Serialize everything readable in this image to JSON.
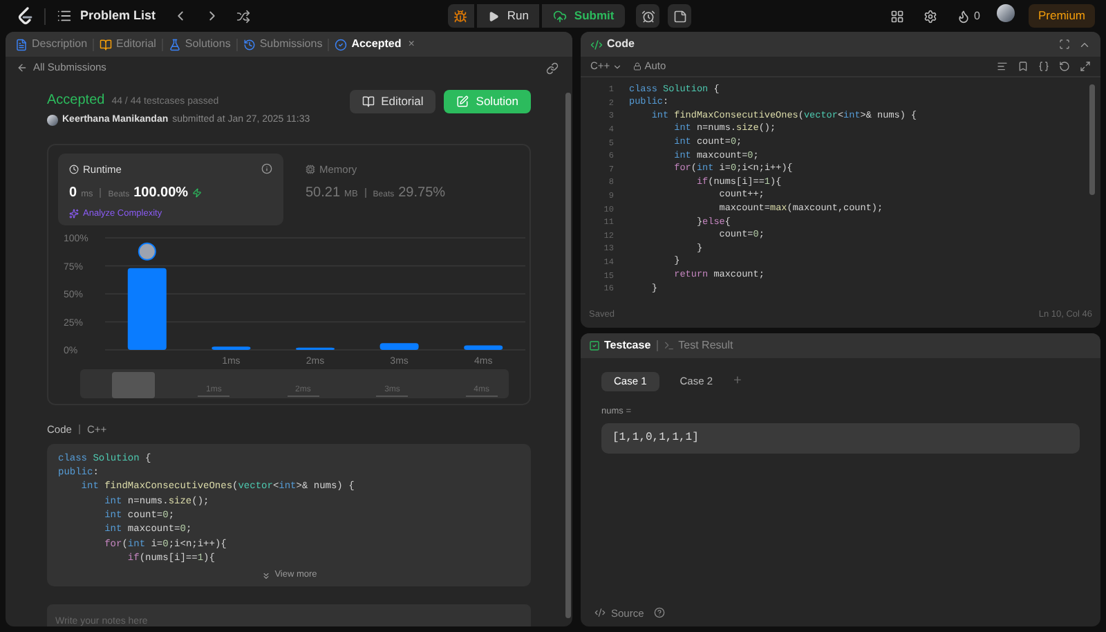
{
  "top_bar": {
    "title": "Problem List",
    "run": "Run",
    "submit": "Submit",
    "streak": "0",
    "premium": "Premium"
  },
  "tabs": [
    {
      "label": "Description",
      "kind": "description",
      "selected": false
    },
    {
      "label": "Editorial",
      "kind": "editorial",
      "selected": false
    },
    {
      "label": "Solutions",
      "kind": "solutions",
      "selected": false
    },
    {
      "label": "Submissions",
      "kind": "submissions",
      "selected": false
    },
    {
      "label": "Accepted",
      "kind": "accepted",
      "selected": true,
      "close": "×"
    }
  ],
  "back_link": "All Submissions",
  "result": {
    "status": "Accepted",
    "testcases": "44 / 44 testcases passed",
    "author": "Keerthana Manikandan",
    "submitted": "submitted at Jan 27, 2025 11:33",
    "buttons": [
      {
        "label": "Editorial",
        "kind": "plain"
      },
      {
        "label": "Solution",
        "kind": "primary"
      }
    ]
  },
  "stats": [
    {
      "title": "Runtime",
      "kind": "runtime",
      "selected": true,
      "value": "0",
      "unit": "ms",
      "beats_label": "Beats",
      "beats": "100.00%",
      "action": "Analyze Complexity"
    },
    {
      "title": "Memory",
      "kind": "memory",
      "selected": false,
      "value": "50.21",
      "unit": "MB",
      "beats_label": "Beats",
      "beats": "29.75%"
    }
  ],
  "chart_data": {
    "type": "bar",
    "x": [
      0,
      1,
      2,
      3,
      4
    ],
    "values": [
      73,
      3,
      2,
      6,
      4
    ],
    "grid": true,
    "xlim": [
      -0.5,
      4.5
    ],
    "ylim": [
      0,
      100
    ],
    "xticks": [
      {
        "value": 1,
        "label": "1ms"
      },
      {
        "value": 2,
        "label": "2ms"
      },
      {
        "value": 3,
        "label": "3ms"
      },
      {
        "value": 4,
        "label": "4ms"
      }
    ],
    "yticks": [
      {
        "value": 100,
        "label": "100%"
      },
      {
        "value": 75,
        "label": "75%"
      },
      {
        "value": 50,
        "label": "50%"
      },
      {
        "value": 25,
        "label": "25%"
      },
      {
        "value": 0,
        "label": "0%"
      }
    ]
  },
  "overview": {
    "labels": [
      "1ms",
      "2ms",
      "3ms",
      "4ms"
    ],
    "level": 0.1
  },
  "code_section": {
    "title": "Code",
    "language": "C++",
    "view_more": "View more",
    "lines": [
      [
        {
          "kind": "kw",
          "text": "class "
        },
        {
          "kind": "type",
          "text": "Solution"
        },
        {
          "kind": "plain",
          "text": " {"
        }
      ],
      [
        {
          "kind": "kw",
          "text": "public"
        },
        {
          "kind": "plain",
          "text": ":"
        }
      ],
      [
        {
          "kind": "kw",
          "text": "    int "
        },
        {
          "kind": "fn",
          "text": "findMaxConsecutiveOnes"
        },
        {
          "kind": "plain",
          "text": "("
        },
        {
          "kind": "type",
          "text": "vector"
        },
        {
          "kind": "plain",
          "text": "<"
        },
        {
          "kind": "kw",
          "text": "int"
        },
        {
          "kind": "plain",
          "text": ">& nums) {"
        }
      ],
      [
        {
          "kind": "kw",
          "text": "        int "
        },
        {
          "kind": "plain",
          "text": "n=nums."
        },
        {
          "kind": "fn",
          "text": "size"
        },
        {
          "kind": "plain",
          "text": "();"
        }
      ],
      [
        {
          "kind": "kw",
          "text": "        int "
        },
        {
          "kind": "plain",
          "text": "count="
        },
        {
          "kind": "num",
          "text": "0"
        },
        {
          "kind": "plain",
          "text": ";"
        }
      ],
      [
        {
          "kind": "kw",
          "text": "        int "
        },
        {
          "kind": "plain",
          "text": "maxcount="
        },
        {
          "kind": "num",
          "text": "0"
        },
        {
          "kind": "plain",
          "text": ";"
        }
      ],
      [
        {
          "kind": "ctl",
          "text": "        for"
        },
        {
          "kind": "plain",
          "text": "("
        },
        {
          "kind": "kw",
          "text": "int "
        },
        {
          "kind": "plain",
          "text": "i="
        },
        {
          "kind": "num",
          "text": "0"
        },
        {
          "kind": "plain",
          "text": ";i<n;i++){"
        }
      ],
      [
        {
          "kind": "ctl",
          "text": "            if"
        },
        {
          "kind": "plain",
          "text": "(nums[i]=="
        },
        {
          "kind": "num",
          "text": "1"
        },
        {
          "kind": "plain",
          "text": "){"
        }
      ]
    ]
  },
  "notes": {
    "placeholder": "Write your notes here"
  },
  "editor": {
    "title": "Code",
    "language": "C++",
    "mode": "Auto",
    "status": "Saved",
    "position": "Ln 10, Col 46",
    "lines": [
      {
        "number": "1",
        "segments": [
          {
            "kind": "kw",
            "text": "class "
          },
          {
            "kind": "type",
            "text": "Solution"
          },
          {
            "kind": "plain",
            "text": " {"
          }
        ]
      },
      {
        "number": "2",
        "segments": [
          {
            "kind": "kw",
            "text": "public"
          },
          {
            "kind": "plain",
            "text": ":"
          }
        ]
      },
      {
        "number": "3",
        "segments": [
          {
            "kind": "kw",
            "text": "    int "
          },
          {
            "kind": "fn",
            "text": "findMaxConsecutiveOnes"
          },
          {
            "kind": "plain",
            "text": "("
          },
          {
            "kind": "type",
            "text": "vector"
          },
          {
            "kind": "plain",
            "text": "<"
          },
          {
            "kind": "kw",
            "text": "int"
          },
          {
            "kind": "plain",
            "text": ">& nums) {"
          }
        ]
      },
      {
        "number": "4",
        "segments": [
          {
            "kind": "kw",
            "text": "        int "
          },
          {
            "kind": "plain",
            "text": "n=nums."
          },
          {
            "kind": "fn",
            "text": "size"
          },
          {
            "kind": "plain",
            "text": "();"
          }
        ]
      },
      {
        "number": "5",
        "segments": [
          {
            "kind": "kw",
            "text": "        int "
          },
          {
            "kind": "plain",
            "text": "count="
          },
          {
            "kind": "num",
            "text": "0"
          },
          {
            "kind": "plain",
            "text": ";"
          }
        ]
      },
      {
        "number": "6",
        "segments": [
          {
            "kind": "kw",
            "text": "        int "
          },
          {
            "kind": "plain",
            "text": "maxcount="
          },
          {
            "kind": "num",
            "text": "0"
          },
          {
            "kind": "plain",
            "text": ";"
          }
        ]
      },
      {
        "number": "7",
        "segments": [
          {
            "kind": "ctl",
            "text": "        for"
          },
          {
            "kind": "plain",
            "text": "("
          },
          {
            "kind": "kw",
            "text": "int "
          },
          {
            "kind": "plain",
            "text": "i="
          },
          {
            "kind": "num",
            "text": "0"
          },
          {
            "kind": "plain",
            "text": ";i<n;i++){"
          }
        ]
      },
      {
        "number": "8",
        "segments": [
          {
            "kind": "ctl",
            "text": "            if"
          },
          {
            "kind": "plain",
            "text": "(nums[i]=="
          },
          {
            "kind": "num",
            "text": "1"
          },
          {
            "kind": "plain",
            "text": "){"
          }
        ]
      },
      {
        "number": "9",
        "segments": [
          {
            "kind": "plain",
            "text": "                count++;"
          }
        ]
      },
      {
        "number": "10",
        "segments": [
          {
            "kind": "plain",
            "text": "                maxcount="
          },
          {
            "kind": "fn",
            "text": "max"
          },
          {
            "kind": "plain",
            "text": "(maxcount,count);"
          }
        ]
      },
      {
        "number": "11",
        "segments": [
          {
            "kind": "plain",
            "text": "            }"
          },
          {
            "kind": "ctl",
            "text": "else"
          },
          {
            "kind": "plain",
            "text": "{"
          }
        ]
      },
      {
        "number": "12",
        "segments": [
          {
            "kind": "plain",
            "text": "                count="
          },
          {
            "kind": "num",
            "text": "0"
          },
          {
            "kind": "plain",
            "text": ";"
          }
        ]
      },
      {
        "number": "13",
        "segments": [
          {
            "kind": "plain",
            "text": "            }"
          }
        ]
      },
      {
        "number": "14",
        "segments": [
          {
            "kind": "plain",
            "text": "        }"
          }
        ]
      },
      {
        "number": "15",
        "segments": [
          {
            "kind": "ctl",
            "text": "        return"
          },
          {
            "kind": "plain",
            "text": " maxcount;"
          }
        ]
      },
      {
        "number": "16",
        "segments": [
          {
            "kind": "plain",
            "text": "    }"
          }
        ]
      }
    ]
  },
  "testcase": {
    "tabs": [
      {
        "label": "Testcase",
        "kind": "testcase",
        "selected": true
      },
      {
        "label": "Test Result",
        "kind": "result",
        "selected": false
      }
    ],
    "cases": [
      {
        "label": "Case 1",
        "selected": true
      },
      {
        "label": "Case 2",
        "selected": false
      }
    ],
    "add": "+",
    "param": "nums =",
    "value": "[1,1,0,1,1,1]",
    "source": "Source"
  }
}
